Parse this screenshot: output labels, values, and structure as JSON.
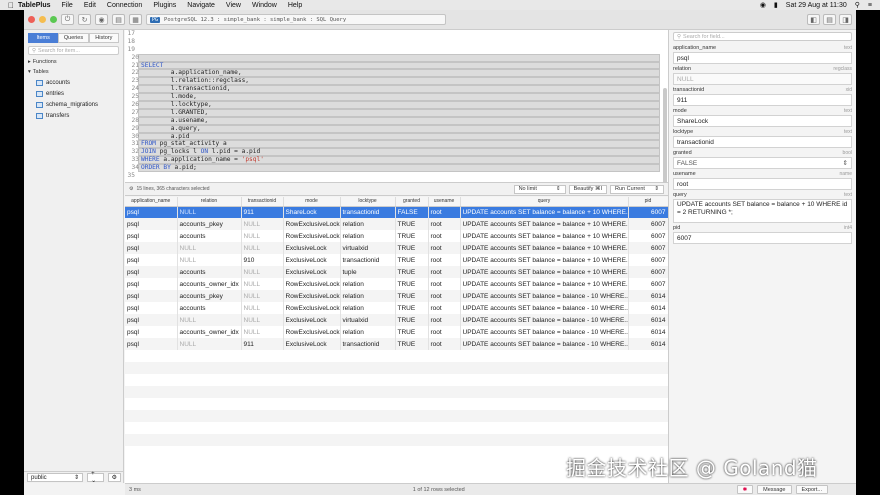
{
  "menubar": {
    "app_name": "TablePlus",
    "items": [
      "File",
      "Edit",
      "Connection",
      "Plugins",
      "Navigate",
      "View",
      "Window",
      "Help"
    ],
    "clock": "Sat 29 Aug at 11:30"
  },
  "toolbar": {
    "engine_badge": "PG",
    "connection_path": "PostgreSQL 12.3 : simple_bank : simple_bank : SQL Query"
  },
  "sidebar": {
    "tabs": [
      "Items",
      "Queries",
      "History"
    ],
    "search_placeholder": "Search for item...",
    "functions_label": "Functions",
    "tables_label": "Tables",
    "tables": [
      "accounts",
      "entries",
      "schema_migrations",
      "transfers"
    ],
    "schema": "public"
  },
  "editor": {
    "lines": [
      {
        "n": "17",
        "t": ""
      },
      {
        "n": "18",
        "t": ""
      },
      {
        "n": "19",
        "t": ""
      },
      {
        "n": "20",
        "t": ""
      },
      {
        "n": "21",
        "t": "SELECT"
      },
      {
        "n": "22",
        "t": "        a.application_name,"
      },
      {
        "n": "23",
        "t": "        l.relation::regclass,"
      },
      {
        "n": "24",
        "t": "        l.transactionid,"
      },
      {
        "n": "25",
        "t": "        l.mode,"
      },
      {
        "n": "26",
        "t": "        l.locktype,"
      },
      {
        "n": "27",
        "t": "        l.GRANTED,"
      },
      {
        "n": "28",
        "t": "        a.usename,"
      },
      {
        "n": "29",
        "t": "        a.query,"
      },
      {
        "n": "30",
        "t": "        a.pid"
      },
      {
        "n": "31",
        "t": "FROM pg_stat_activity a"
      },
      {
        "n": "32",
        "t": "JOIN pg_locks l ON l.pid = a.pid"
      },
      {
        "n": "33",
        "t": "WHERE a.application_name = 'psql'"
      },
      {
        "n": "34",
        "t": "ORDER BY a.pid;"
      },
      {
        "n": "35",
        "t": ""
      }
    ],
    "selection_info": "15 lines, 365 characters selected",
    "limit": "No limit",
    "beautify": "Beautify ⌘I",
    "run": "Run Current"
  },
  "grid": {
    "columns": [
      "application_name",
      "relation",
      "transactionid",
      "mode",
      "locktype",
      "granted",
      "usename",
      "query",
      "pid"
    ],
    "rows": [
      [
        "psql",
        "NULL",
        "911",
        "ShareLock",
        "transactionid",
        "FALSE",
        "root",
        "UPDATE accounts SET balance = balance + 10 WHERE...",
        "6007"
      ],
      [
        "psql",
        "accounts_pkey",
        "NULL",
        "RowExclusiveLock",
        "relation",
        "TRUE",
        "root",
        "UPDATE accounts SET balance = balance + 10 WHERE...",
        "6007"
      ],
      [
        "psql",
        "accounts",
        "NULL",
        "RowExclusiveLock",
        "relation",
        "TRUE",
        "root",
        "UPDATE accounts SET balance = balance + 10 WHERE...",
        "6007"
      ],
      [
        "psql",
        "NULL",
        "NULL",
        "ExclusiveLock",
        "virtualxid",
        "TRUE",
        "root",
        "UPDATE accounts SET balance = balance + 10 WHERE...",
        "6007"
      ],
      [
        "psql",
        "NULL",
        "910",
        "ExclusiveLock",
        "transactionid",
        "TRUE",
        "root",
        "UPDATE accounts SET balance = balance + 10 WHERE...",
        "6007"
      ],
      [
        "psql",
        "accounts",
        "NULL",
        "ExclusiveLock",
        "tuple",
        "TRUE",
        "root",
        "UPDATE accounts SET balance = balance + 10 WHERE...",
        "6007"
      ],
      [
        "psql",
        "accounts_owner_idx",
        "NULL",
        "RowExclusiveLock",
        "relation",
        "TRUE",
        "root",
        "UPDATE accounts SET balance = balance + 10 WHERE...",
        "6007"
      ],
      [
        "psql",
        "accounts_pkey",
        "NULL",
        "RowExclusiveLock",
        "relation",
        "TRUE",
        "root",
        "UPDATE accounts SET balance = balance - 10 WHERE...",
        "6014"
      ],
      [
        "psql",
        "accounts",
        "NULL",
        "RowExclusiveLock",
        "relation",
        "TRUE",
        "root",
        "UPDATE accounts SET balance = balance - 10 WHERE...",
        "6014"
      ],
      [
        "psql",
        "NULL",
        "NULL",
        "ExclusiveLock",
        "virtualxid",
        "TRUE",
        "root",
        "UPDATE accounts SET balance = balance - 10 WHERE...",
        "6014"
      ],
      [
        "psql",
        "accounts_owner_idx",
        "NULL",
        "RowExclusiveLock",
        "relation",
        "TRUE",
        "root",
        "UPDATE accounts SET balance = balance - 10 WHERE...",
        "6014"
      ],
      [
        "psql",
        "NULL",
        "911",
        "ExclusiveLock",
        "transactionid",
        "TRUE",
        "root",
        "UPDATE accounts SET balance = balance - 10 WHERE...",
        "6014"
      ]
    ]
  },
  "detail": {
    "search_placeholder": "Search for field...",
    "fields": [
      {
        "name": "application_name",
        "type": "text",
        "value": "psql"
      },
      {
        "name": "relation",
        "type": "regclass",
        "value": "NULL"
      },
      {
        "name": "transactionid",
        "type": "xid",
        "value": "911"
      },
      {
        "name": "mode",
        "type": "text",
        "value": "ShareLock"
      },
      {
        "name": "locktype",
        "type": "text",
        "value": "transactionid"
      },
      {
        "name": "granted",
        "type": "bool",
        "value": "FALSE"
      },
      {
        "name": "usename",
        "type": "name",
        "value": "root"
      },
      {
        "name": "query",
        "type": "text",
        "value": "UPDATE accounts SET balance = balance + 10 WHERE id = 2 RETURNING *;"
      },
      {
        "name": "pid",
        "type": "int4",
        "value": "6007"
      }
    ]
  },
  "footer": {
    "timing": "3 ms",
    "rows_info": "1 of 12 rows selected",
    "message_btn": "Message",
    "export_btn": "Export..."
  },
  "watermark": "掘金技术社区 @ Goland猫",
  "colors": {
    "selection": "#3a7be0",
    "keyword": "#2f56c8",
    "string": "#c03b2f"
  }
}
